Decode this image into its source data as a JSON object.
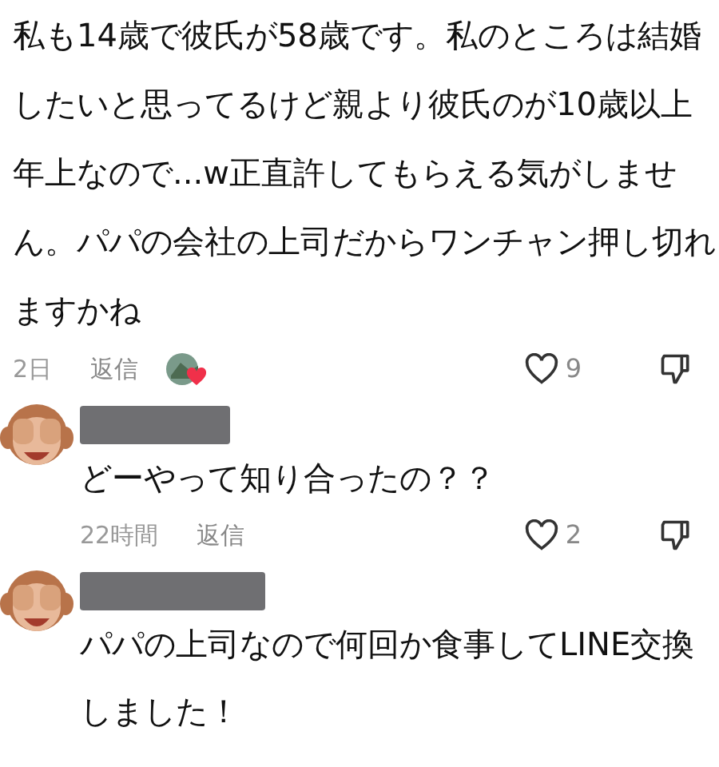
{
  "comment": {
    "text": "私も14歳で彼氏が58歳です。私のところは結婚したいと思ってるけど親より彼氏のが10歳以上年上なので...w正直許してもらえる気がしません。パパの会社の上司だからワンチャン押し切れますかね",
    "time": "2日",
    "reply": "返信",
    "liked_by_creator": true,
    "likes": "9"
  },
  "replies": [
    {
      "text": "どーやって知り合ったの？？",
      "time": "22時間",
      "reply": "返信",
      "likes": "2"
    },
    {
      "text": "パパの上司なので何回か食事してLINE交換しました！"
    }
  ]
}
